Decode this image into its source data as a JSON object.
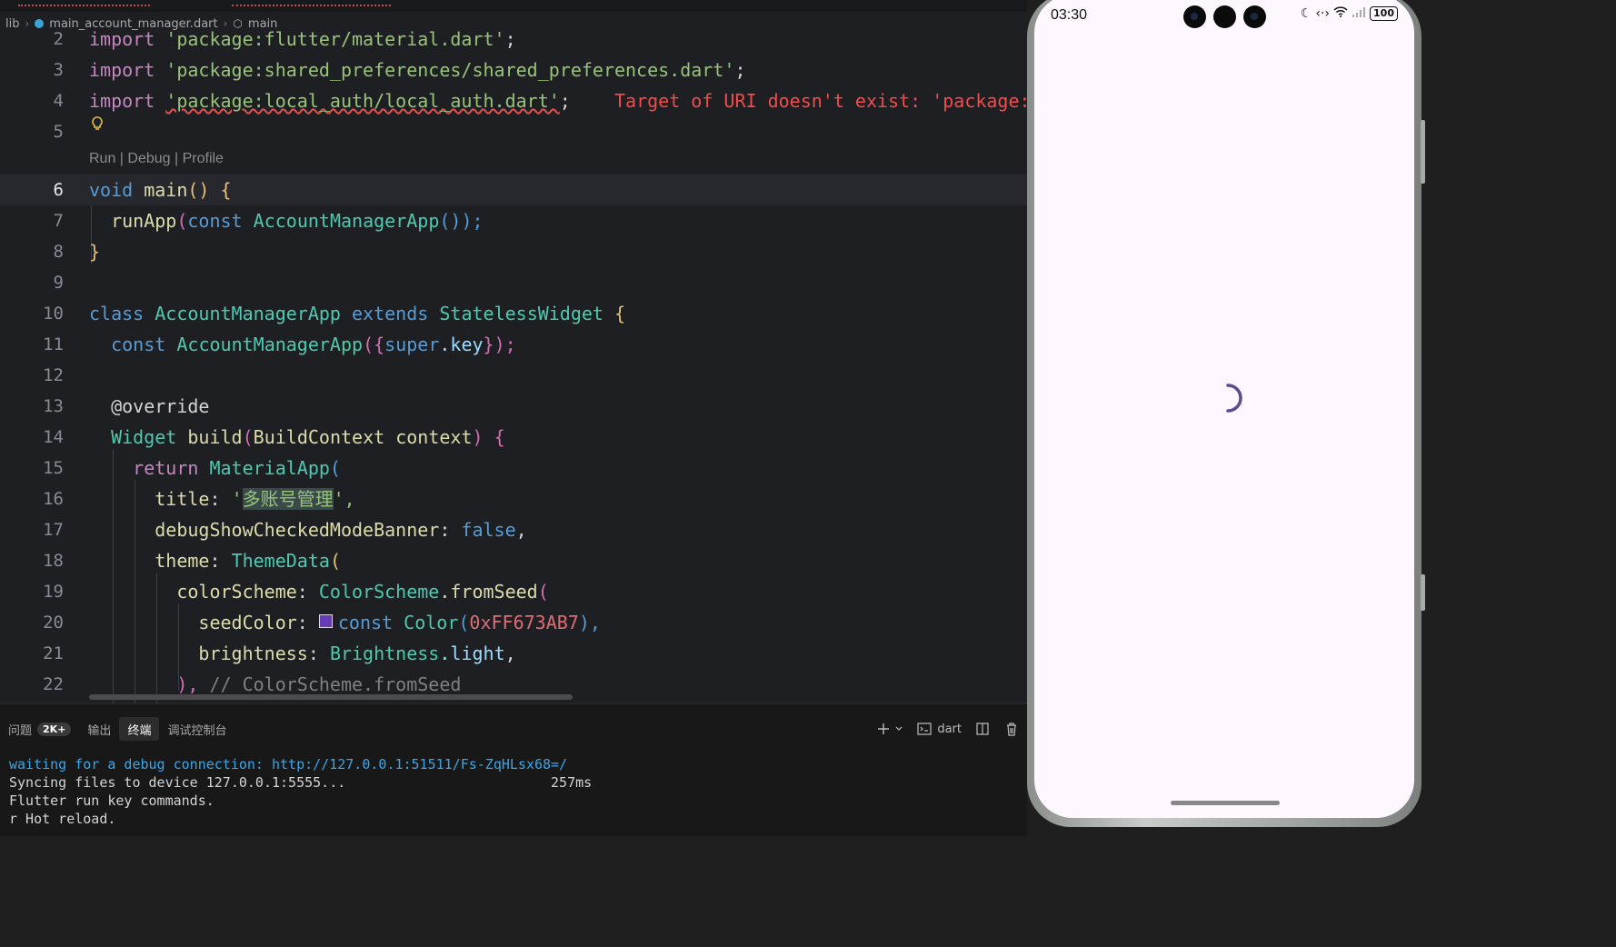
{
  "breadcrumb": {
    "folder": "lib",
    "file": "main_account_manager.dart",
    "symbol": "main"
  },
  "codelens": "Run | Debug | Profile",
  "lines": {
    "n2": "2",
    "n3": "3",
    "n4": "4",
    "n5": "5",
    "n6": "6",
    "n7": "7",
    "n8": "8",
    "n9": "9",
    "n10": "10",
    "n11": "11",
    "n12": "12",
    "n13": "13",
    "n14": "14",
    "n15": "15",
    "n16": "16",
    "n17": "17",
    "n18": "18",
    "n19": "19",
    "n20": "20",
    "n21": "21",
    "n22": "22"
  },
  "code": {
    "import_kw": "import",
    "l2_str": "'package:flutter/material.dart'",
    "l3_str": "'package:shared_preferences/shared_preferences.dart'",
    "l4_str": "'package:local_auth/local_auth.dart'",
    "l4_error": "Target of URI doesn't exist: 'package:l",
    "semi": ";",
    "l6_void": "void",
    "l6_main": "main",
    "l6_rest": "() {",
    "l7_fn": "runApp",
    "l7_const": "const",
    "l7_cls": "AccountManagerApp",
    "l7_rest": "());",
    "l8": "}",
    "l10_class": "class",
    "l10_name": "AccountManagerApp",
    "l10_extends": "extends",
    "l10_parent": "StatelessWidget",
    "l10_brace": "{",
    "l11_const": "const",
    "l11_name": "AccountManagerApp",
    "l11_open": "({",
    "l11_super": "super",
    "l11_key": ".key",
    "l11_close": "});",
    "l13": "@override",
    "l14_type": "Widget",
    "l14_fn": "build",
    "l14_paren": "(",
    "l14_ptype": "BuildContext",
    "l14_param": "context",
    "l14_close": ") {",
    "l15_return": "return",
    "l15_cls": "MaterialApp",
    "l15_paren": "(",
    "l16_prop": "title",
    "l16_colon": ":",
    "l16_q1": "'",
    "l16_val": "多账号管理",
    "l16_q2": "',",
    "l17_prop": "debugShowCheckedModeBanner",
    "l17_val": "false",
    "comma": ",",
    "l18_prop": "theme",
    "l18_cls": "ThemeData",
    "l19_prop": "colorScheme",
    "l19_cls": "ColorScheme",
    "l19_fn": ".fromSeed",
    "l20_prop": "seedColor",
    "l20_const": "const",
    "l20_cls": "Color",
    "l20_num": "0xFF673AB7",
    "l20_close": "),",
    "l21_prop": "brightness",
    "l21_cls": "Brightness",
    "l21_val": ".light",
    "l22_close": "),",
    "l22_cmt": "// ColorScheme.fromSeed"
  },
  "panel": {
    "tabs": [
      "问题",
      "输出",
      "终端",
      "调试控制台"
    ],
    "problems_badge": "2K+",
    "shell_label": "dart",
    "terminal_lines": {
      "l1": "waiting for a debug connection: http://127.0.0.1:51511/Fs-ZqHLsx68=/",
      "l2": "Syncing files to device 127.0.0.1:5555...                         257ms",
      "l3": "",
      "l4": "Flutter run key commands.",
      "l5": "r Hot reload."
    }
  },
  "phone": {
    "time": "03:30",
    "battery": "100",
    "spinner_color": "#5e4a8f",
    "background": "#fef7ff"
  },
  "icons": {
    "add": "add-terminal-icon",
    "chevron": "chevron-down-icon",
    "terminal": "terminal-icon",
    "split": "split-terminal-icon",
    "trash": "trash-icon",
    "bulb": "lightbulb-icon"
  }
}
